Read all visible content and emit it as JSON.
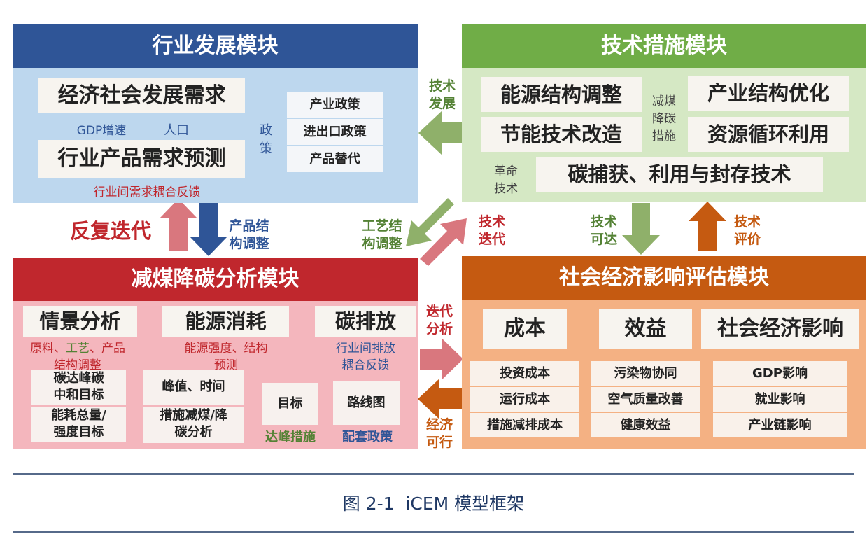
{
  "industry": {
    "title": "行业发展模块",
    "econ_demand": "经济社会发展需求",
    "gdp_growth": "GDP增速",
    "population": "人口",
    "product_demand": "行业产品需求预测",
    "feedback": "行业间需求耦合反馈",
    "policy_label": [
      "政",
      "策"
    ],
    "policies": [
      "产业政策",
      "进出口政策",
      "产品替代"
    ]
  },
  "tech": {
    "title": "技术措施模块",
    "energy_structure": "能源结构调整",
    "energy_saving": "节能技术改造",
    "industry_structure": "产业结构优化",
    "resource_recycle": "资源循环利用",
    "measures_label": [
      "减煤",
      "降碳",
      "措施"
    ],
    "revolution_label": [
      "革命",
      "技术"
    ],
    "ccus": "碳捕获、利用与封存技术"
  },
  "reduction": {
    "title": "减煤降碳分析模块",
    "scenario": "情景分析",
    "energy_use": "能源消耗",
    "emission": "碳排放",
    "scenario_sub": {
      "p1": "原料、",
      "p2": "工艺",
      "p3": "、产品",
      "line2": "结构调整"
    },
    "energy_sub": [
      "能源强度、结构",
      "预测"
    ],
    "emission_sub": [
      "行业间排放",
      "耦合反馈"
    ],
    "peak_goal": [
      "碳达峰碳",
      "中和目标"
    ],
    "energy_goal": [
      "能耗总量/",
      "强度目标"
    ],
    "peak_time": "峰值、时间",
    "measure_analysis": [
      "措施减煤/降",
      "碳分析"
    ],
    "target": "目标",
    "roadmap": "路线图",
    "peak_measures": "达峰措施",
    "support_policy": "配套政策"
  },
  "socio": {
    "title": "社会经济影响评估模块",
    "headers": [
      "成本",
      "效益",
      "社会经济影响"
    ],
    "cost_items": [
      "投资成本",
      "运行成本",
      "措施减排成本"
    ],
    "benefit_items": [
      "污染物协同",
      "空气质量改善",
      "健康效益"
    ],
    "impact_items": [
      "GDP影响",
      "就业影响",
      "产业链影响"
    ]
  },
  "links": {
    "tech_dev": [
      "技术",
      "发展"
    ],
    "product_struct": [
      "产品结",
      "构调整"
    ],
    "iterate": "反复迭代",
    "process_struct": [
      "工艺结",
      "构调整"
    ],
    "tech_iterate": [
      "技术",
      "迭代"
    ],
    "tech_reach": [
      "技术",
      "可达"
    ],
    "tech_eval": [
      "技术",
      "评价"
    ],
    "iter_analysis": [
      "迭代",
      "分析"
    ],
    "econ_feasible": [
      "经济",
      "可行"
    ]
  },
  "caption": "图 2-1  iCEM 模型框架",
  "colors": {
    "blue_header": "#2f5597",
    "blue_body": "#bdd7ee",
    "green_header": "#70ad47",
    "green_body": "#d5e8c4",
    "red_header": "#c0272d",
    "red_body": "#f4b6bd",
    "orange_header": "#c55a11",
    "orange_body": "#f4b183",
    "label_red": "#c0272d",
    "label_green": "#548235",
    "label_blue": "#2f5597"
  }
}
